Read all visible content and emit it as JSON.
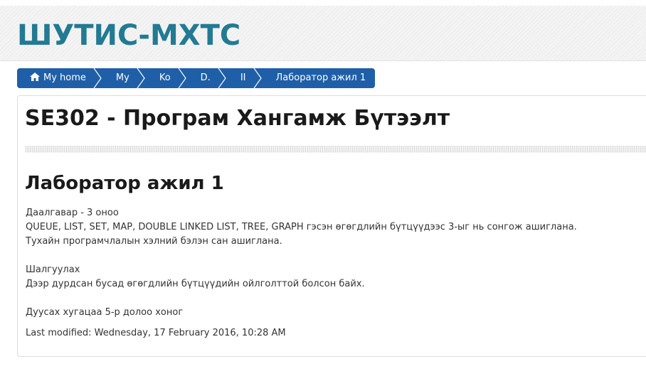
{
  "header": {
    "site_title": "ШУТИС-МХТС"
  },
  "breadcrumb": {
    "items": [
      {
        "label": "My home",
        "icon": "home-icon"
      },
      {
        "label": "My"
      },
      {
        "label": "Ko"
      },
      {
        "label": "D."
      },
      {
        "label": "II"
      },
      {
        "label": "Лаборатор ажил 1"
      }
    ],
    "bg_color": "#1f5fa8"
  },
  "main": {
    "course_title": "SE302 - Програм Хангамж Бүтээлт",
    "page_title": "Лаборатор ажил 1",
    "lines": [
      "Даалгавар - 3 оноо",
      "QUEUE, LIST, SET, MAP, DOUBLE LINKED LIST, TREE, GRAPH гэсэн өгөгдлийн бүтцүүдээс 3-ыг нь сонгож ашиглана.",
      "Тухайн програмчлалын хэлний бэлэн сан ашиглана.",
      "Шалгуулах",
      "Дээр дурдсан бусад өгөгдлийн бүтцүүдийн ойлголттой болсон байх.",
      "Дуусах хугацаа 5-р долоо хоног"
    ],
    "last_modified": "Last modified: Wednesday, 17 February 2016, 10:28 AM"
  },
  "colors": {
    "title_accent": "#227a93",
    "breadcrumb": "#1f5fa8",
    "text": "#333333"
  }
}
